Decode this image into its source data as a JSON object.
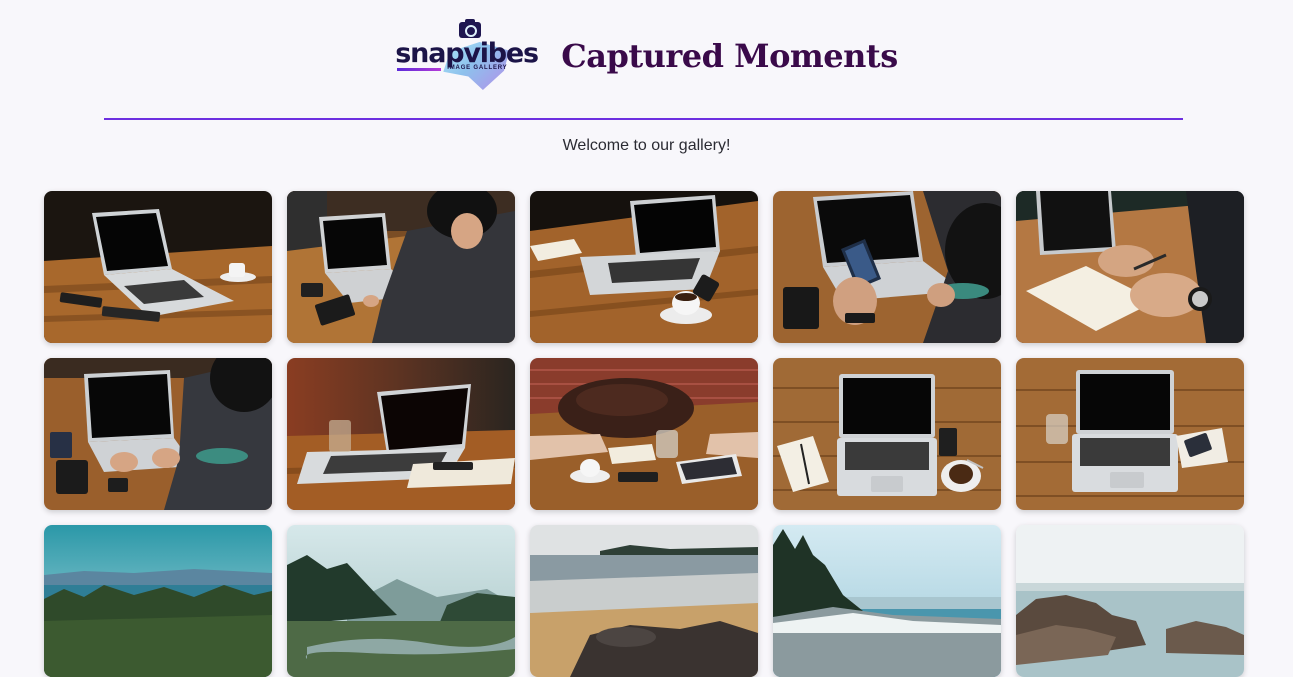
{
  "header": {
    "logo_text": "snapvibes",
    "logo_subtext": "IMAGE GALLERY",
    "title": "Captured Moments"
  },
  "intro": {
    "welcome": "Welcome to our gallery!"
  },
  "colors": {
    "accent": "#6d2fe0",
    "title": "#3a0a4a",
    "background": "#f8f7fb"
  },
  "gallery": {
    "images": [
      {
        "scene": "laptop-on-wooden-table-with-coffee"
      },
      {
        "scene": "person-typing-on-laptop-outdoors"
      },
      {
        "scene": "laptop-notebook-and-coffee-on-table"
      },
      {
        "scene": "person-holding-phone-at-laptop"
      },
      {
        "scene": "hands-writing-in-notebook-by-laptop"
      },
      {
        "scene": "person-typing-on-laptop-with-phones"
      },
      {
        "scene": "laptop-and-water-glass-on-table"
      },
      {
        "scene": "leather-bag-and-tablet-on-table"
      },
      {
        "scene": "laptop-notebook-coffee-top-view"
      },
      {
        "scene": "laptop-glass-and-phone-top-view"
      },
      {
        "scene": "forest-and-mountain-landscape"
      },
      {
        "scene": "misty-forest-river-landscape"
      },
      {
        "scene": "beach-with-rocks-and-islands"
      },
      {
        "scene": "coastline-with-trees-and-sea"
      },
      {
        "scene": "rocky-shore-and-calm-sea"
      }
    ]
  }
}
